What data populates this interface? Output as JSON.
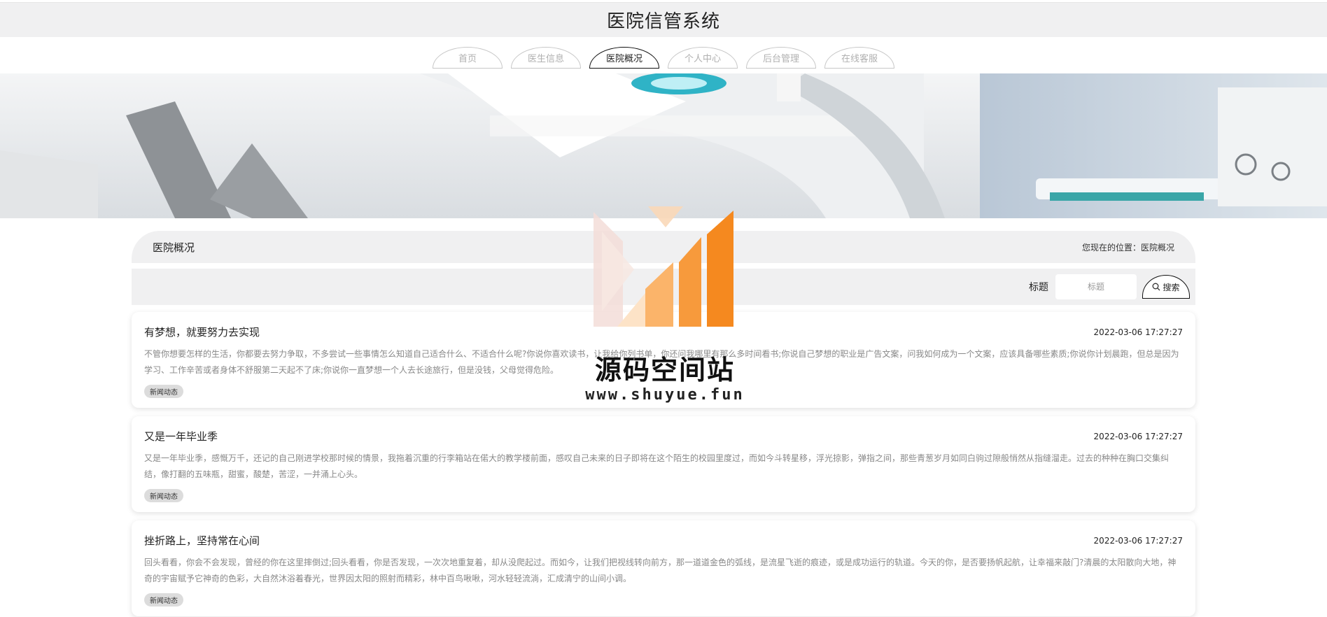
{
  "app": {
    "title": "医院信管系统"
  },
  "nav": {
    "items": [
      {
        "label": "首页",
        "active": false
      },
      {
        "label": "医生信息",
        "active": false
      },
      {
        "label": "医院概况",
        "active": true
      },
      {
        "label": "个人中心",
        "active": false
      },
      {
        "label": "后台管理",
        "active": false
      },
      {
        "label": "在线客服",
        "active": false
      }
    ]
  },
  "breadcrumb": {
    "title": "医院概况",
    "location": "您现在的位置：医院概况"
  },
  "search": {
    "label": "标题",
    "placeholder": "标题",
    "button_label": "搜索",
    "icon": "search-icon"
  },
  "news": [
    {
      "title": "有梦想，就要努力去实现",
      "time": "2022-03-06 17:27:27",
      "desc": "不管你想要怎样的生活，你都要去努力争取，不多尝试一些事情怎么知道自己适合什么、不适合什么呢?你说你喜欢读书，让我给你列书单，你还问我哪里有那么多时间看书;你说自己梦想的职业是广告文案，问我如何成为一个文案，应该具备哪些素质;你说你计划晨跑，但总是因为学习、工作辛苦或者身体不舒服第二天起不了床;你说你一直梦想一个人去长途旅行，但是没钱，父母觉得危险。",
      "tag": "新闻动态"
    },
    {
      "title": "又是一年毕业季",
      "time": "2022-03-06 17:27:27",
      "desc": "又是一年毕业季，感慨万千，还记的自己刚进学校那时候的情景，我拖着沉重的行李箱站在偌大的教学楼前面，感叹自己未来的日子即将在这个陌生的校园里度过，而如今斗转星移，浮光掠影，弹指之间，那些青葱岁月如同白驹过隙般悄然从指缝溜走。过去的种种在胸口交集纠结，像打翻的五味瓶，甜蜜，酸楚，苦涩，一并涌上心头。",
      "tag": "新闻动态"
    },
    {
      "title": "挫折路上，坚持常在心间",
      "time": "2022-03-06 17:27:27",
      "desc": "回头看看，你会不会发现，曾经的你在这里摔倒过;回头看看，你是否发现，一次次地重复着，却从没爬起过。而如今，让我们把视线转向前方，那一道道金色的弧线，是流星飞逝的痕迹，或是成功运行的轨道。今天的你，是否要扬帆起航，让幸福来敲门?清晨的太阳散向大地，神奇的宇宙赋予它神奇的色彩，大自然沐浴着春光，世界因太阳的照射而精彩，林中百鸟啾啾，河水轻轻流淌，汇成清宁的山间小调。",
      "tag": "新闻动态"
    }
  ],
  "watermark": {
    "name": "源码空间站",
    "url": "www.shuyue.fun"
  },
  "colors": {
    "accent": "#111111",
    "bar_bg": "#f0f0f1",
    "logo_orange": "#f5891f"
  }
}
